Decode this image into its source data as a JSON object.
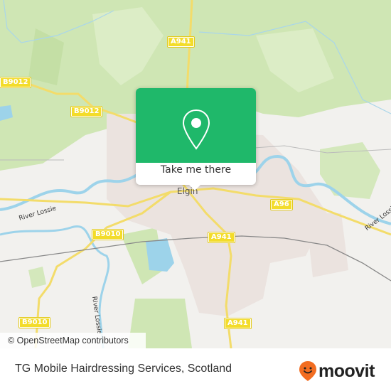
{
  "map": {
    "attribution": "© OpenStreetMap contributors",
    "place_labels": [
      {
        "name": "Elgin"
      }
    ],
    "road_labels": [
      {
        "name": "A941"
      },
      {
        "name": "B9012"
      },
      {
        "name": "B9012"
      },
      {
        "name": "A96"
      },
      {
        "name": "B9010"
      },
      {
        "name": "A941"
      },
      {
        "name": "B9010"
      },
      {
        "name": "A941"
      }
    ],
    "river_labels": [
      {
        "name": "River Lossie"
      },
      {
        "name": "River Lossie"
      },
      {
        "name": "River Lossie"
      }
    ],
    "colors": {
      "land": "#f2f1ee",
      "forest": "#cfe6b4",
      "urban": "#ebe3df",
      "water": "#9dd3ea",
      "road": "#f3dc6a",
      "popup_green": "#1fb86a"
    }
  },
  "popup": {
    "icon": "location-pin-icon",
    "cta_label": "Take me there"
  },
  "footer": {
    "title": "TG Mobile Hairdressing Services, Scotland",
    "brand": "moovit",
    "brand_icon": "moovit-smile-pin-icon",
    "brand_color": "#f26d21"
  }
}
